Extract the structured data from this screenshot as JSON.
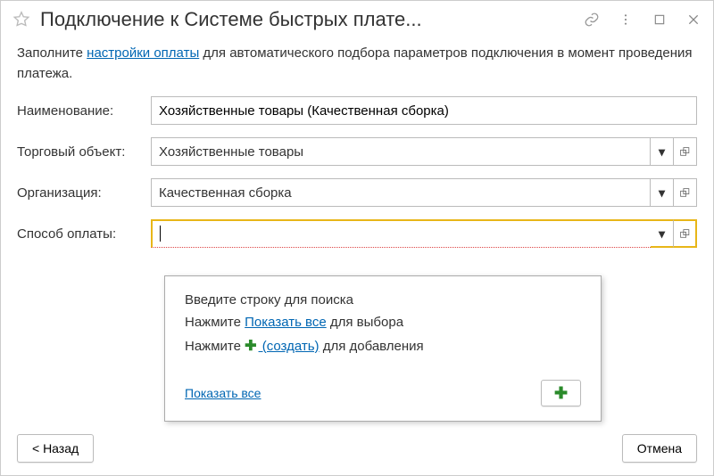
{
  "window": {
    "title": "Подключение к Системе быстрых плате..."
  },
  "info": {
    "part1": "Заполните ",
    "link": "настройки оплаты",
    "part2": " для автоматического подбора параметров подключения в момент проведения платежа."
  },
  "labels": {
    "name": "Наименование:",
    "trade_object": "Торговый объект:",
    "organization": "Организация:",
    "payment_method": "Способ оплаты:"
  },
  "values": {
    "name": "Хозяйственные товары (Качественная сборка)",
    "trade_object": "Хозяйственные товары",
    "organization": "Качественная сборка",
    "payment_method": ""
  },
  "dropdown": {
    "search_hint": "Введите строку для поиска",
    "show_all_prefix": "Нажмите ",
    "show_all_link": "Показать все",
    "show_all_suffix": " для выбора",
    "create_prefix": "Нажмите ",
    "create_link": " (создать)",
    "create_suffix": " для добавления",
    "footer_show_all": "Показать все"
  },
  "buttons": {
    "back": "< Назад",
    "cancel": "Отмена"
  }
}
